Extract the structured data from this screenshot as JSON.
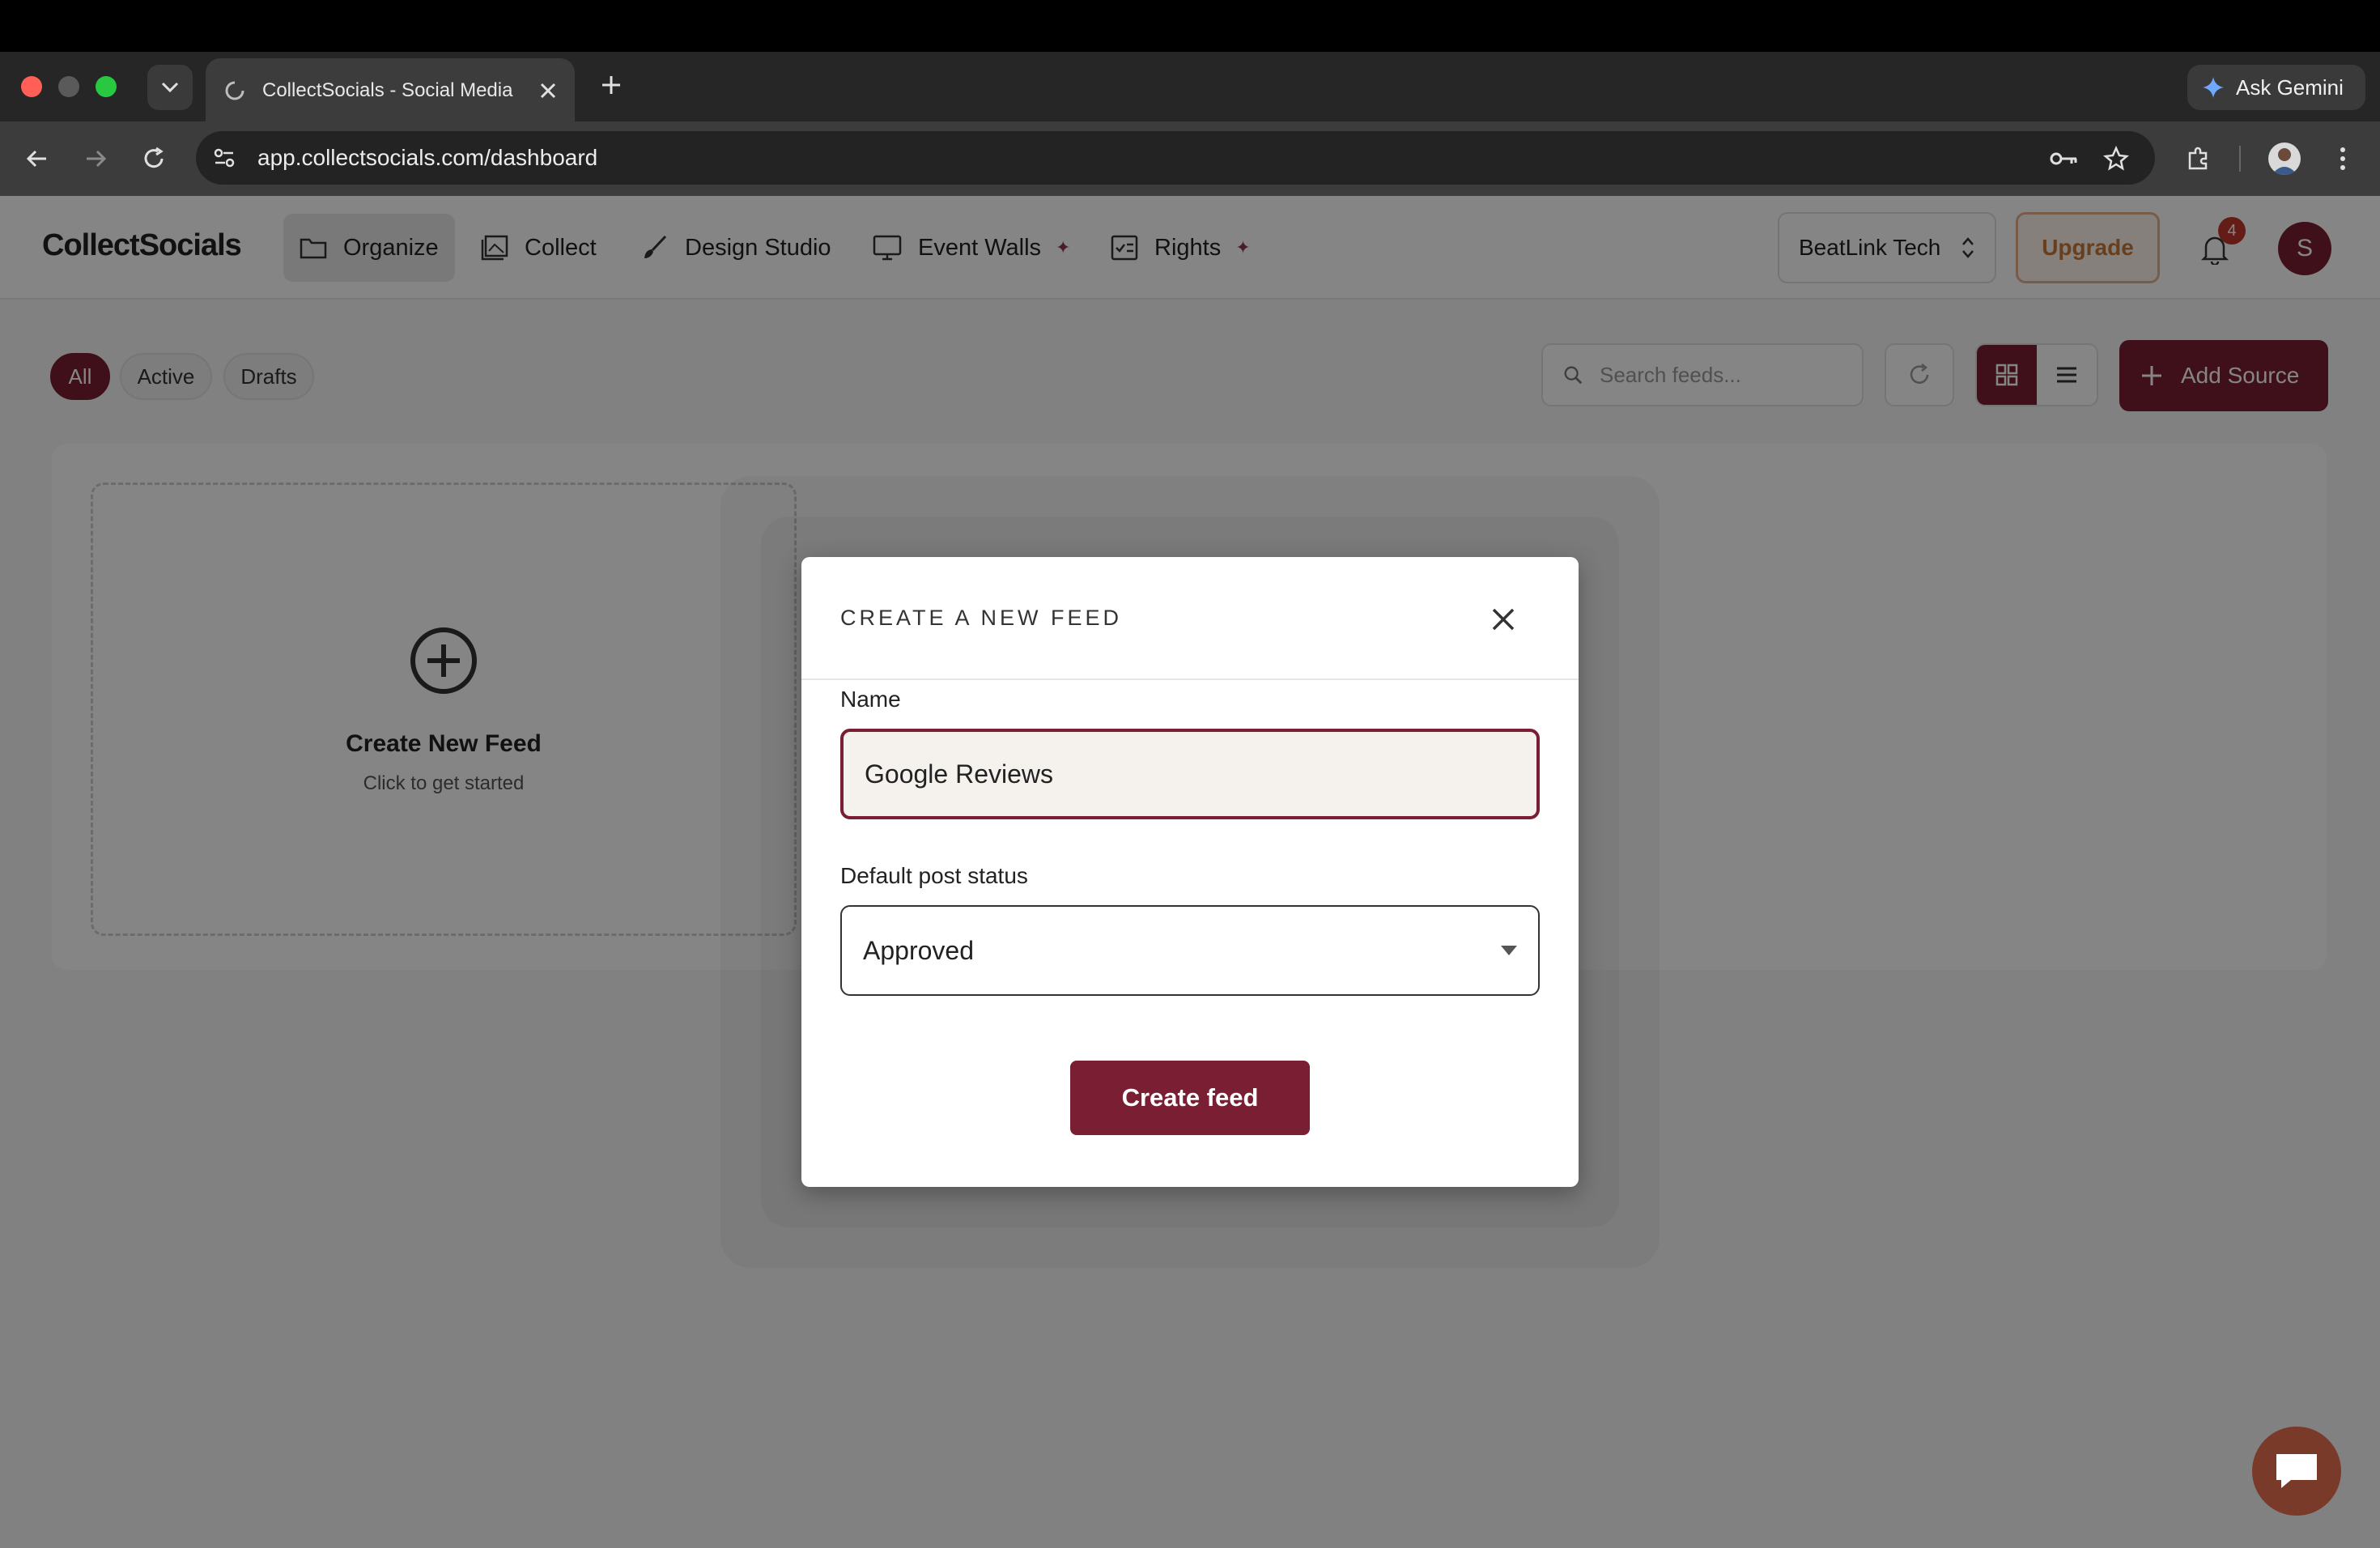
{
  "browser": {
    "tab_title": "CollectSocials - Social Media",
    "url": "app.collectsocials.com/dashboard",
    "ask_gemini_label": "Ask Gemini"
  },
  "header": {
    "logo_text": "CollectSocials",
    "nav": [
      {
        "label": "Organize",
        "icon": "folder-icon",
        "active": true
      },
      {
        "label": "Collect",
        "icon": "gallery-icon"
      },
      {
        "label": "Design Studio",
        "icon": "brush-icon"
      },
      {
        "label": "Event Walls",
        "icon": "monitor-icon",
        "sparkle": true
      },
      {
        "label": "Rights",
        "icon": "rights-icon",
        "sparkle": true
      }
    ],
    "workspace": "BeatLink Tech",
    "upgrade_label": "Upgrade",
    "notification_count": "4",
    "avatar_initial": "S"
  },
  "toolbar": {
    "filters": [
      "All",
      "Active",
      "Drafts"
    ],
    "active_filter": "All",
    "search_placeholder": "Search feeds...",
    "add_source_label": "Add Source"
  },
  "new_feed_card": {
    "title": "Create New Feed",
    "subtitle": "Click to get started"
  },
  "modal": {
    "title": "CREATE A NEW FEED",
    "name_label": "Name",
    "name_value": "Google Reviews",
    "status_label": "Default post status",
    "status_value": "Approved",
    "submit_label": "Create feed"
  },
  "colors": {
    "brand": "#7a1f33",
    "upgrade_text": "#c7793a",
    "badge": "#c0392b"
  }
}
